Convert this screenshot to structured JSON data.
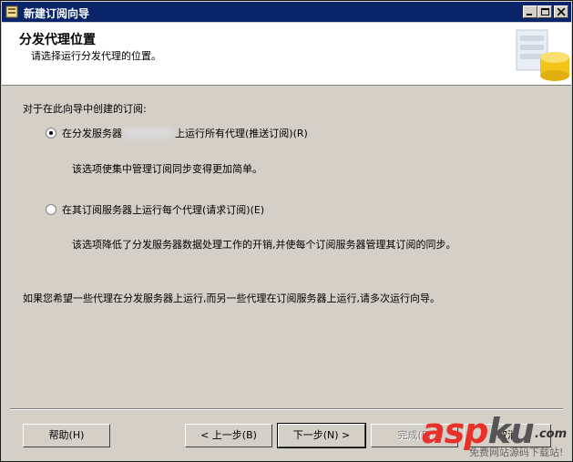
{
  "window": {
    "title": "新建订阅向导"
  },
  "header": {
    "title": "分发代理位置",
    "subtitle": "请选择运行分发代理的位置。"
  },
  "main": {
    "prompt": "对于在此向导中创建的订阅:",
    "option_push": {
      "label_before": "在分发服务器",
      "label_after": "上运行所有代理(推送订阅)(R)",
      "selected": true,
      "description": "该选项使集中管理订阅同步变得更加简单。"
    },
    "option_pull": {
      "label": "在其订阅服务器上运行每个代理(请求订阅)(E)",
      "selected": false,
      "description": "该选项降低了分发服务器数据处理工作的开销,并使每个订阅服务器管理其订阅的同步。"
    },
    "footnote": "如果您希望一些代理在分发服务器上运行,而另一些代理在订阅服务器上运行,请多次运行向导。"
  },
  "buttons": {
    "help": "帮助(H)",
    "back": "< 上一步(B)",
    "next": "下一步(N) >",
    "finish": "完成(F)",
    "cancel": "取消"
  },
  "watermark": {
    "brand_a": "asp",
    "brand_b": "ku",
    "suffix": ".com",
    "tagline": "免费网站源码下载站!"
  }
}
